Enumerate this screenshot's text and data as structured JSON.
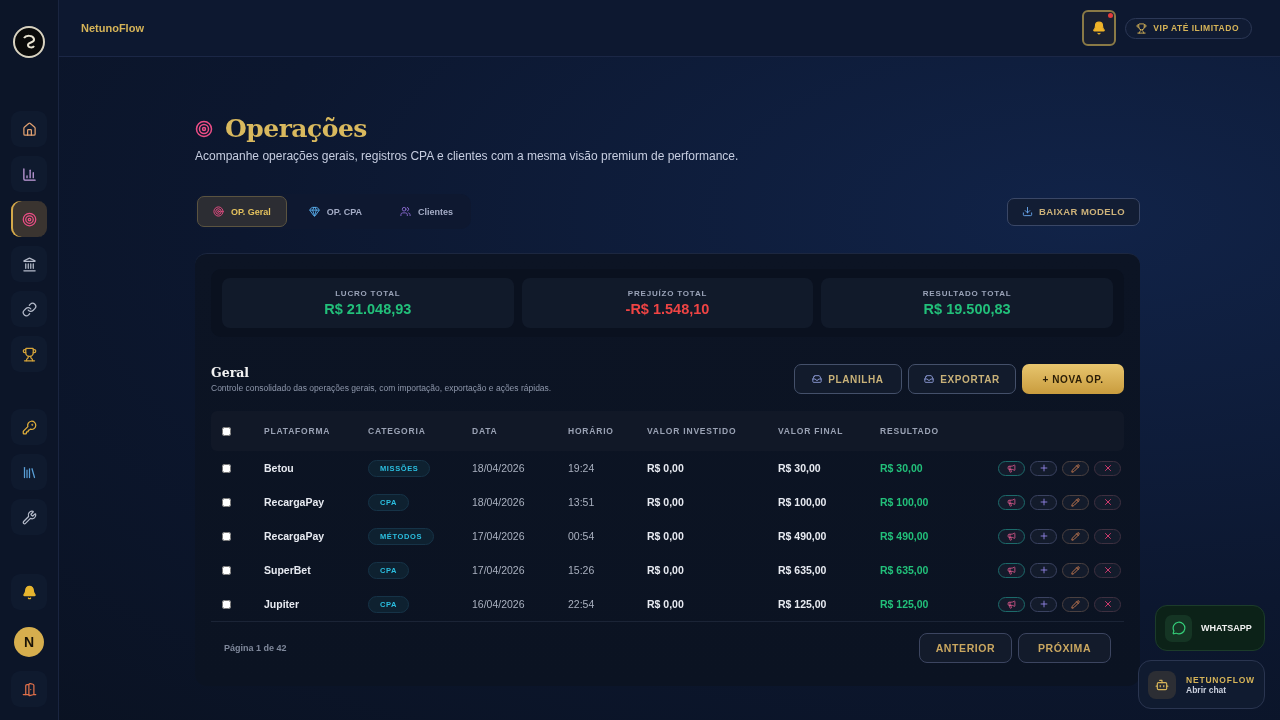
{
  "header": {
    "brand": "NetunoFlow",
    "notifications": {
      "unread": true
    },
    "vip": "VIP ATÉ ILIMITADO"
  },
  "sidebar": {
    "items": [
      {
        "selected": false
      },
      {
        "selected": false
      },
      {
        "selected": true
      },
      {
        "selected": false
      },
      {
        "selected": false
      },
      {
        "selected": false
      },
      {
        "selected": false
      },
      {
        "selected": false
      },
      {
        "selected": false
      },
      {
        "selected": false
      }
    ],
    "avatar": "N"
  },
  "page": {
    "title": "Operações",
    "subtitle": "Acompanhe operações gerais, registros CPA e clientes com a mesma visão premium de performance."
  },
  "tabs": [
    {
      "label": "OP. Geral",
      "selected": true
    },
    {
      "label": "OP. CPA",
      "selected": false
    },
    {
      "label": "Clientes",
      "selected": false
    }
  ],
  "download_button": "BAIXAR MODELO",
  "stats": [
    {
      "label": "LUCRO TOTAL",
      "value": "R$ 21.048,93",
      "kind": "positive"
    },
    {
      "label": "PREJUÍZO TOTAL",
      "value": "-R$ 1.548,10",
      "kind": "negative"
    },
    {
      "label": "RESULTADO TOTAL",
      "value": "R$ 19.500,83",
      "kind": "positive"
    }
  ],
  "section": {
    "title": "Geral",
    "subtitle": "Controle consolidado das operações gerais, com importação, exportação e ações rápidas.",
    "buttons": [
      {
        "label": "PLANILHA",
        "kind": "secondary"
      },
      {
        "label": "EXPORTAR",
        "kind": "secondary"
      },
      {
        "label": "+ NOVA OP.",
        "kind": "primary"
      }
    ]
  },
  "table": {
    "select_all": {
      "checked": false
    },
    "columns": [
      "PLATAFORMA",
      "CATEGORIA",
      "DATA",
      "HORÁRIO",
      "VALOR INVESTIDO",
      "VALOR FINAL",
      "RESULTADO"
    ],
    "rows": [
      {
        "checked": false,
        "cells": [
          "Betou",
          "MISSÕES",
          "18/04/2026",
          "19:24",
          "R$ 0,00",
          "R$ 30,00",
          "R$ 30,00"
        ]
      },
      {
        "checked": false,
        "cells": [
          "RecargaPay",
          "CPA",
          "18/04/2026",
          "13:51",
          "R$ 0,00",
          "R$ 100,00",
          "R$ 100,00"
        ]
      },
      {
        "checked": false,
        "cells": [
          "RecargaPay",
          "MÉTODOS",
          "17/04/2026",
          "00:54",
          "R$ 0,00",
          "R$ 490,00",
          "R$ 490,00"
        ]
      },
      {
        "checked": false,
        "cells": [
          "SuperBet",
          "CPA",
          "17/04/2026",
          "15:26",
          "R$ 0,00",
          "R$ 635,00",
          "R$ 635,00"
        ]
      },
      {
        "checked": false,
        "cells": [
          "Jupiter",
          "CPA",
          "16/04/2026",
          "22:54",
          "R$ 0,00",
          "R$ 125,00",
          "R$ 125,00"
        ]
      }
    ]
  },
  "pagination": {
    "info": "Página 1 de 42",
    "buttons": [
      "ANTERIOR",
      "PRÓXIMA"
    ]
  },
  "whatsapp": {
    "label": "WHATSAPP"
  },
  "chat": {
    "title": "NETUNOFLOW",
    "subtitle": "Abrir chat"
  }
}
